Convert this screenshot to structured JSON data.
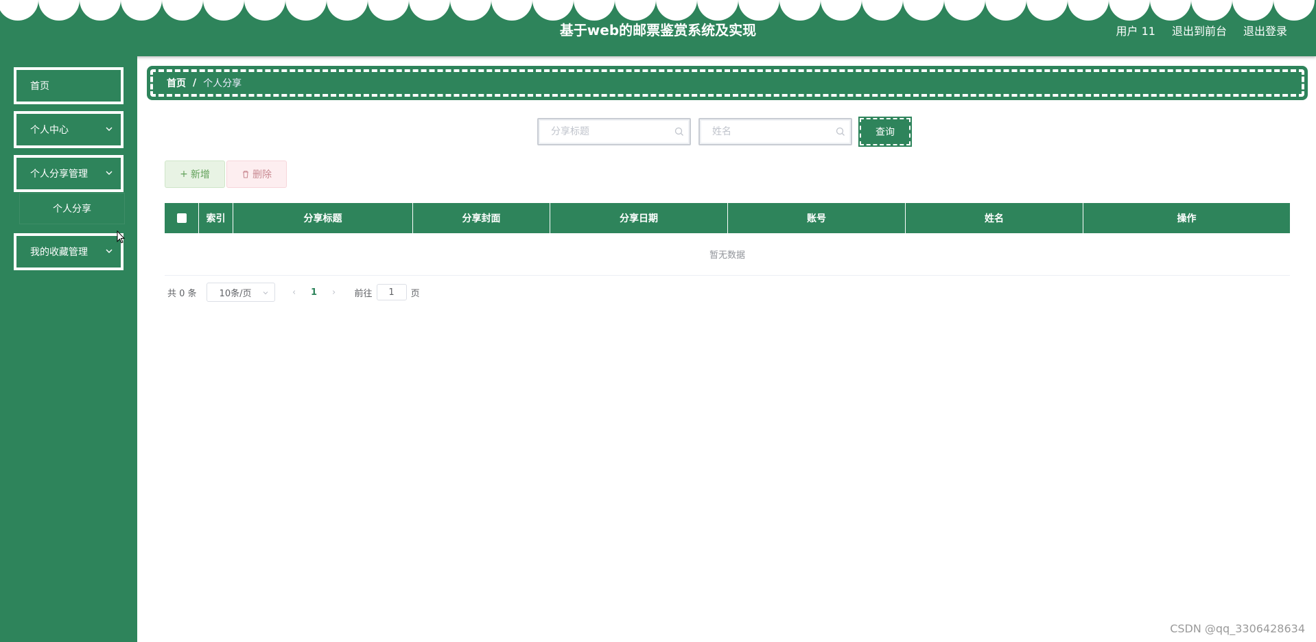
{
  "header": {
    "title": "基于web的邮票鉴赏系统及实现",
    "user_label": "用户 11",
    "to_front_label": "退出到前台",
    "logout_label": "退出登录"
  },
  "sidebar": {
    "items": [
      {
        "label": "首页"
      },
      {
        "label": "个人中心"
      },
      {
        "label": "个人分享管理"
      },
      {
        "label": "个人分享"
      },
      {
        "label": "我的收藏管理"
      }
    ]
  },
  "breadcrumb": {
    "home": "首页",
    "separator": "/",
    "current": "个人分享"
  },
  "search": {
    "title_placeholder": "分享标题",
    "name_placeholder": "姓名",
    "query_label": "查询"
  },
  "actions": {
    "add_label": "新增",
    "delete_label": "删除"
  },
  "table": {
    "columns": [
      "索引",
      "分享标题",
      "分享封面",
      "分享日期",
      "账号",
      "姓名",
      "操作"
    ],
    "empty_text": "暂无数据"
  },
  "pagination": {
    "total_text": "共 0 条",
    "page_size": "10条/页",
    "current_page": "1",
    "goto_label": "前往",
    "goto_value": "1",
    "page_suffix": "页"
  },
  "watermark": "CSDN @qq_3306428634",
  "colors": {
    "primary": "#2e845b",
    "add_bg": "#e8f3e4",
    "delete_bg": "#fdeef0"
  }
}
